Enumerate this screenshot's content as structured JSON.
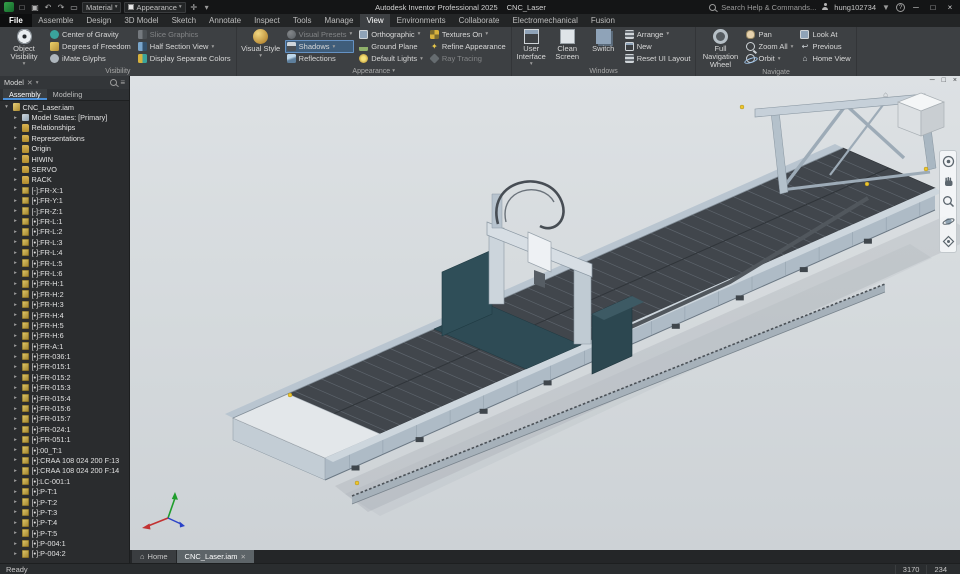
{
  "titlebar": {
    "app_title": "Autodesk Inventor Professional 2025",
    "doc_title": "CNC_Laser",
    "material_label": "Material",
    "appearance_label": "Appearance",
    "search_placeholder": "Search Help & Commands...",
    "user_name": "hung102734"
  },
  "ribbon_tabs": {
    "active": "View",
    "items": [
      "File",
      "Assemble",
      "Design",
      "3D Model",
      "Sketch",
      "Annotate",
      "Inspect",
      "Tools",
      "Manage",
      "View",
      "Environments",
      "Collaborate",
      "Electromechanical",
      "Fusion"
    ]
  },
  "ribbon": {
    "visibility": {
      "label": "Visibility",
      "object_visibility": "Object Visibility",
      "col1": [
        "Center of Gravity",
        "Degrees of Freedom",
        "iMate Glyphs"
      ],
      "col2": [
        "Slice Graphics",
        "Half Section View",
        "Display Separate Colors"
      ]
    },
    "appearance": {
      "label": "Appearance",
      "visual_style": "Visual Style",
      "col1": [
        "Visual Presets",
        "Shadows",
        "Reflections"
      ],
      "col2": [
        "Orthographic",
        "Ground Plane",
        "Default Lights"
      ],
      "col3": [
        "Textures On",
        "Refine Appearance",
        "Ray Tracing"
      ]
    },
    "windows": {
      "label": "Windows",
      "big": [
        "User Interface",
        "Clean Screen",
        "Switch"
      ],
      "col1": [
        "Arrange",
        "New",
        "Reset UI Layout"
      ]
    },
    "navigate": {
      "label": "Navigate",
      "big": "Full Navigation Wheel",
      "col1": [
        "Pan",
        "Zoom All",
        "Orbit"
      ],
      "col2": [
        "Look At",
        "Previous",
        "Home View"
      ]
    }
  },
  "browser": {
    "pane_title": "Model",
    "tabs": [
      "Assembly",
      "Modeling"
    ],
    "active_tab": "Assembly",
    "tree": [
      {
        "label": "CNC_Laser.iam",
        "level": 0,
        "type": "assembly",
        "expanded": true
      },
      {
        "label": "Model States: [Primary]",
        "level": 1,
        "type": "states"
      },
      {
        "label": "Relationships",
        "level": 1,
        "type": "folder"
      },
      {
        "label": "Representations",
        "level": 1,
        "type": "folder"
      },
      {
        "label": "Origin",
        "level": 1,
        "type": "folder"
      },
      {
        "label": "HIWIN",
        "level": 1,
        "type": "folder"
      },
      {
        "label": "SERVO",
        "level": 1,
        "type": "folder"
      },
      {
        "label": "RACK",
        "level": 1,
        "type": "folder"
      },
      {
        "label": "[-]:FR-X:1",
        "level": 1,
        "type": "part"
      },
      {
        "label": "[•]:FR-Y:1",
        "level": 1,
        "type": "part"
      },
      {
        "label": "[-]:FR-Z:1",
        "level": 1,
        "type": "part"
      },
      {
        "label": "[•]:FR-L:1",
        "level": 1,
        "type": "part"
      },
      {
        "label": "[•]:FR-L:2",
        "level": 1,
        "type": "part"
      },
      {
        "label": "[•]:FR-L:3",
        "level": 1,
        "type": "part"
      },
      {
        "label": "[•]:FR-L:4",
        "level": 1,
        "type": "part"
      },
      {
        "label": "[•]:FR-L:5",
        "level": 1,
        "type": "part"
      },
      {
        "label": "[•]:FR-L:6",
        "level": 1,
        "type": "part"
      },
      {
        "label": "[•]:FR-H:1",
        "level": 1,
        "type": "part"
      },
      {
        "label": "[•]:FR-H:2",
        "level": 1,
        "type": "part"
      },
      {
        "label": "[•]:FR-H:3",
        "level": 1,
        "type": "part"
      },
      {
        "label": "[•]:FR-H:4",
        "level": 1,
        "type": "part"
      },
      {
        "label": "[•]:FR-H:5",
        "level": 1,
        "type": "part"
      },
      {
        "label": "[•]:FR-H:6",
        "level": 1,
        "type": "part"
      },
      {
        "label": "[•]:FR-A:1",
        "level": 1,
        "type": "part"
      },
      {
        "label": "[•]:FR-036:1",
        "level": 1,
        "type": "part"
      },
      {
        "label": "[•]:FR-015:1",
        "level": 1,
        "type": "part"
      },
      {
        "label": "[•]:FR-015:2",
        "level": 1,
        "type": "part"
      },
      {
        "label": "[•]:FR-015:3",
        "level": 1,
        "type": "part"
      },
      {
        "label": "[•]:FR-015:4",
        "level": 1,
        "type": "part"
      },
      {
        "label": "[•]:FR-015:6",
        "level": 1,
        "type": "part"
      },
      {
        "label": "[•]:FR-015:7",
        "level": 1,
        "type": "part"
      },
      {
        "label": "[•]:FR-024:1",
        "level": 1,
        "type": "part"
      },
      {
        "label": "[•]:FR-051:1",
        "level": 1,
        "type": "part"
      },
      {
        "label": "[•]:00_T:1",
        "level": 1,
        "type": "part"
      },
      {
        "label": "[•]:CRAA 108 024 200 F:13",
        "level": 1,
        "type": "part"
      },
      {
        "label": "[•]:CRAA 108 024 200 F:14",
        "level": 1,
        "type": "part"
      },
      {
        "label": "[•]:LC-001:1",
        "level": 1,
        "type": "part"
      },
      {
        "label": "[•]:P-T:1",
        "level": 1,
        "type": "part"
      },
      {
        "label": "[•]:P-T:2",
        "level": 1,
        "type": "part"
      },
      {
        "label": "[•]:P-T:3",
        "level": 1,
        "type": "part"
      },
      {
        "label": "[•]:P-T:4",
        "level": 1,
        "type": "part"
      },
      {
        "label": "[•]:P-T:5",
        "level": 1,
        "type": "part"
      },
      {
        "label": "[•]:P-004:1",
        "level": 1,
        "type": "part"
      },
      {
        "label": "[•]:P-004:2",
        "level": 1,
        "type": "part"
      }
    ]
  },
  "doctabs": {
    "home_label": "Home",
    "document_label": "CNC_Laser.iam"
  },
  "statusbar": {
    "message": "Ready",
    "value1": "3170",
    "value2": "234"
  },
  "colors": {
    "accent_blue": "#4a90d9",
    "selection_blue": "#3f5d7a",
    "viewport_bg": "#d5dadd",
    "machine_steel": "#aebbc6",
    "machine_bed": "#41464c",
    "machine_teal": "#2f4e58",
    "marker_yellow": "#ecc52e"
  }
}
